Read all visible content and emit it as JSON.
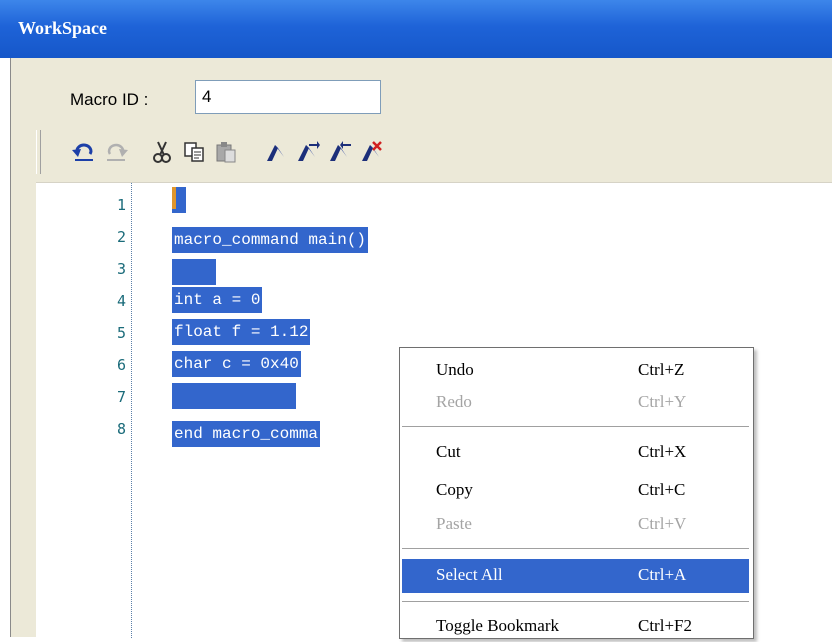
{
  "window": {
    "title": "WorkSpace"
  },
  "macro": {
    "label": "Macro ID :",
    "id_value": "4"
  },
  "toolbar": {
    "buttons": [
      {
        "name": "undo-icon"
      },
      {
        "name": "redo-icon"
      },
      {
        "name": "cut-icon"
      },
      {
        "name": "copy-icon"
      },
      {
        "name": "paste-icon"
      },
      {
        "name": "toggle-bookmark-icon"
      },
      {
        "name": "next-bookmark-icon"
      },
      {
        "name": "previous-bookmark-icon"
      },
      {
        "name": "clear-bookmarks-icon"
      }
    ]
  },
  "editor": {
    "lines": [
      {
        "no": "1",
        "text": ""
      },
      {
        "no": "2",
        "text": "macro_command main()"
      },
      {
        "no": "3",
        "text": ""
      },
      {
        "no": "4",
        "text": "int a = 0"
      },
      {
        "no": "5",
        "text": "float f = 1.12"
      },
      {
        "no": "6",
        "text": "char c = 0x40"
      },
      {
        "no": "7",
        "text": ""
      },
      {
        "no": "8",
        "text": "end macro_comma"
      }
    ],
    "selection_color": "#3366cc"
  },
  "context_menu": {
    "items": [
      {
        "label": "Undo",
        "shortcut": "Ctrl+Z",
        "enabled": true
      },
      {
        "label": "Redo",
        "shortcut": "Ctrl+Y",
        "enabled": false
      },
      {
        "label": "Cut",
        "shortcut": "Ctrl+X",
        "enabled": true
      },
      {
        "label": "Copy",
        "shortcut": "Ctrl+C",
        "enabled": true
      },
      {
        "label": "Paste",
        "shortcut": "Ctrl+V",
        "enabled": false
      },
      {
        "label": "Select All",
        "shortcut": "Ctrl+A",
        "enabled": true,
        "highlighted": true
      },
      {
        "label": "Toggle Bookmark",
        "shortcut": "Ctrl+F2",
        "enabled": true
      }
    ]
  }
}
